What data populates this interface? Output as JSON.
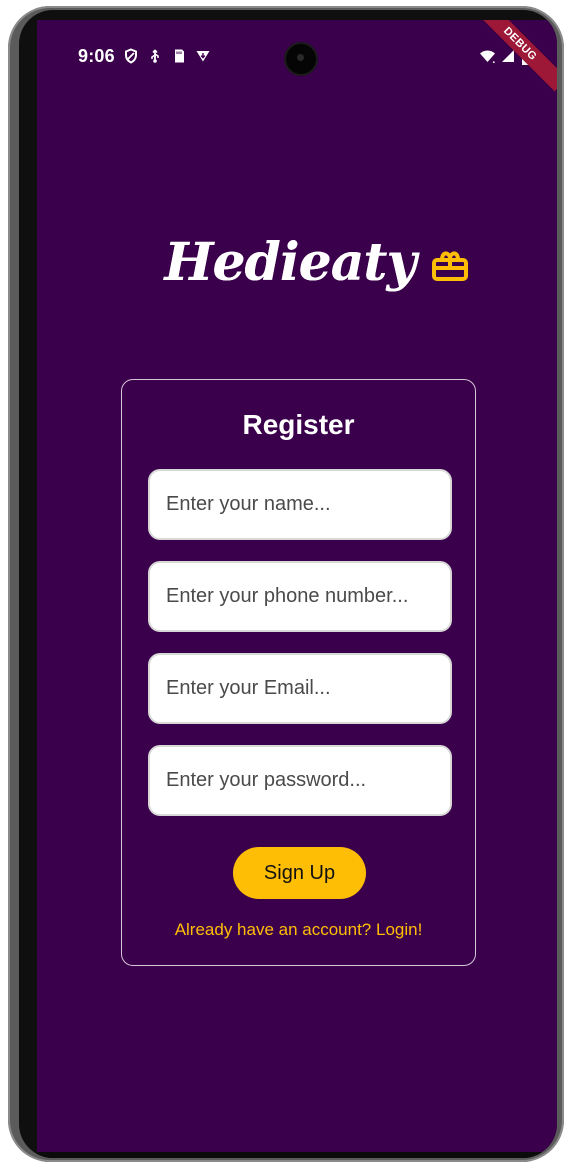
{
  "status_bar": {
    "time": "9:06"
  },
  "app": {
    "debug_label": "DEBUG",
    "brand_name": "Hedieaty",
    "colors": {
      "background": "#3b004b",
      "accent": "#ffbe06",
      "card_border": "#ffffff",
      "debug_ribbon": "#9d1737"
    }
  },
  "register": {
    "title": "Register",
    "fields": {
      "name_placeholder": "Enter your name...",
      "phone_placeholder": "Enter your phone number...",
      "email_placeholder": "Enter your Email...",
      "password_placeholder": "Enter your password..."
    },
    "signup_label": "Sign Up",
    "login_link": "Already have an account? Login!"
  },
  "icons": {
    "status_left": [
      "shield-icon",
      "usb-icon",
      "sd-card-icon",
      "download-icon"
    ],
    "status_right": [
      "wifi-icon",
      "signal-icon",
      "battery-icon"
    ],
    "brand": "gift-box-icon"
  }
}
